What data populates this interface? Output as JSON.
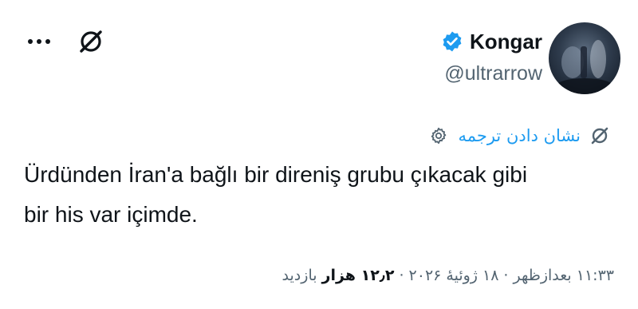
{
  "author": {
    "display_name": "Kongar",
    "handle": "@ultrarrow",
    "verified": true,
    "badge_color": "#1d9bf0"
  },
  "icons": {
    "more": "more-horizontal-icon",
    "grok": "grok-slash-icon",
    "translate": "translate-slash-icon",
    "settings": "settings-gear-icon"
  },
  "translate": {
    "label": "نشان دادن ترجمه"
  },
  "tweet": {
    "text": "Ürdünden İran'a bağlı bir direniş grubu çıkacak gibi\nbir his var içimde."
  },
  "meta": {
    "time": "۱۱:۳۳ بعدازظهر",
    "date": "۱۸ ژوئیهٔ ۲۰۲۶",
    "views_count": "۱۲٫۲ هزار",
    "views_label": "بازدید",
    "separator": "·"
  },
  "colors": {
    "accent": "#1d9bf0",
    "text_primary": "#0f1419",
    "text_secondary": "#536471"
  }
}
